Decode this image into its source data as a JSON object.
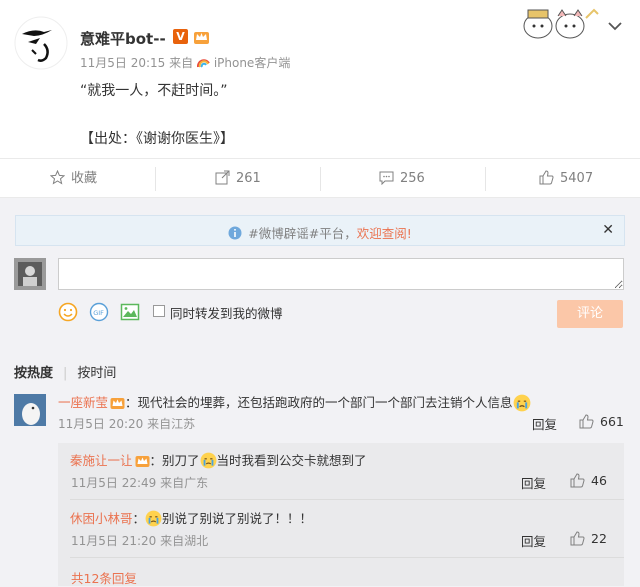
{
  "post": {
    "username": "意难平bot--",
    "verified_badge": "V",
    "crown_badge": "crown-icon",
    "date": "11月5日 20:15",
    "source_prefix": "来自",
    "source": "iPhone客户端",
    "body_line1": "“就我一人，不赶时间。”",
    "body_line2": "【出处：《谢谢你医生》】"
  },
  "actions": {
    "favorite": "收藏",
    "repost": "261",
    "comment": "256",
    "like": "5407"
  },
  "notice": {
    "prefix": "#微博辟谣#平台，",
    "link": "欢迎查阅!"
  },
  "composer": {
    "input_value": "",
    "checkbox_label": "同时转发到我的微博",
    "submit": "评论"
  },
  "sort": {
    "hot": "按热度",
    "time": "按时间"
  },
  "comments": [
    {
      "user": "一座新莹",
      "text": "：现代社会的埋葬，还包括跑政府的一个部门一个部门去注销个人信息",
      "meta": "11月5日 20:20 来自江苏",
      "reply": "回复",
      "likes": "661"
    }
  ],
  "replies": [
    {
      "user": "秦施让一让",
      "text_a": "：别刀了",
      "text_b": "当时我看到公交卡就想到了",
      "meta": "11月5日 22:49 来自广东",
      "reply": "回复",
      "likes": "46"
    },
    {
      "user": "休困小林哥",
      "text_a": "：",
      "text_b": "别说了别说了别说了！！！",
      "meta": "11月5日 21:20 来自湖北",
      "reply": "回复",
      "likes": "22"
    }
  ],
  "more_replies": "共12条回复",
  "colors": {
    "accent": "#eb7350",
    "submit_bg": "#fbc7a8",
    "notice_bg": "#eaf2f8"
  }
}
